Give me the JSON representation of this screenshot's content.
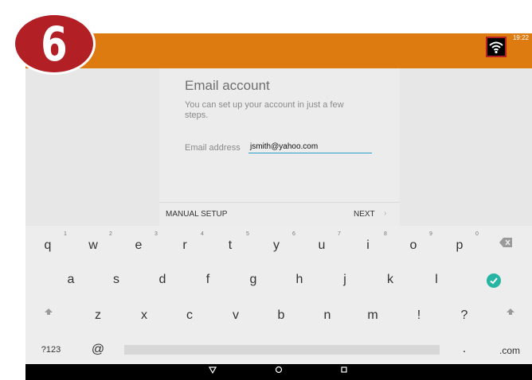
{
  "step_badge": "6",
  "status": {
    "time": "19:22",
    "wifi_icon": "wifi-icon"
  },
  "dialog": {
    "title": "Email account",
    "subtitle": "You can set up your account in just a few steps.",
    "email_label": "Email address",
    "email_value": "jsmith@yahoo.com",
    "manual_setup": "MANUAL SETUP",
    "next": "NEXT",
    "next_arrow": "›"
  },
  "keyboard": {
    "row1": [
      "q",
      "w",
      "e",
      "r",
      "t",
      "y",
      "u",
      "i",
      "o",
      "p"
    ],
    "row1_numbers": [
      "1",
      "2",
      "3",
      "4",
      "5",
      "6",
      "7",
      "8",
      "9",
      "0"
    ],
    "row2": [
      "a",
      "s",
      "d",
      "f",
      "g",
      "h",
      "j",
      "k",
      "l"
    ],
    "row3": [
      "z",
      "x",
      "c",
      "v",
      "b",
      "n",
      "m",
      "!",
      "?"
    ],
    "bottom": {
      "symbols": "?123",
      "at": "@",
      "period": ".",
      "dotcom": ".com"
    }
  },
  "colors": {
    "statusbar": "#dd7b10",
    "badge": "#b21f24",
    "accent": "#2d9cc7",
    "enter": "#27b5a3"
  }
}
